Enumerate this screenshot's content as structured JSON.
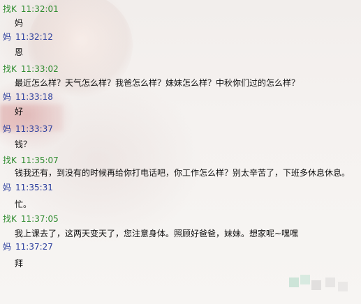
{
  "messages": [
    {
      "sender": "找K",
      "time": "11:32:01",
      "text": "妈"
    },
    {
      "sender": "妈",
      "time": "11:32:12",
      "text": "恩"
    },
    {
      "sender": "找K",
      "time": "11:33:02",
      "text": "最近怎么样？天气怎么样？我爸怎么样？妹妹怎么样？中秋你们过的怎么样？"
    },
    {
      "sender": "妈",
      "time": "11:33:18",
      "text": "好"
    },
    {
      "sender": "妈",
      "time": "11:33:37",
      "text": "钱？"
    },
    {
      "sender": "找K",
      "time": "11:35:07",
      "text": "钱我还有，到没有的时候再给你打电话吧，你工作怎么样？别太辛苦了，下班多休息休息。"
    },
    {
      "sender": "妈",
      "time": "11:35:31",
      "text": "忙。"
    },
    {
      "sender": "找K",
      "time": "11:37:05",
      "text": "我上课去了，这两天变天了，您注意身体。照顾好爸爸，妹妹。想家呢~嘿嘿"
    },
    {
      "sender": "妈",
      "time": "11:37:27",
      "text": "拜"
    }
  ],
  "colors": {
    "sender_k": "#2e8b2e",
    "sender_mom": "#2c3f9e",
    "message_text": "#111111"
  }
}
